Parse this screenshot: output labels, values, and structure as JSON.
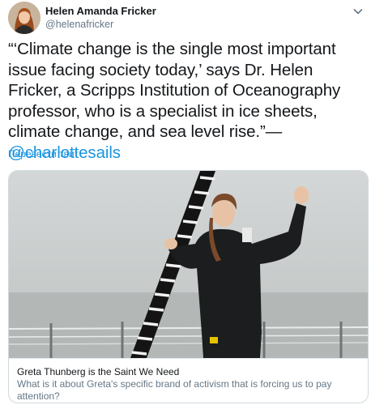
{
  "tweet": {
    "author": {
      "display_name": "Helen Amanda Fricker",
      "handle": "@helenafricker"
    },
    "text": "“‘Climate change is the single most important issue facing society today,’ says Dr. Helen Fricker, a Scripps Institution of Oceanography professor, who is a specialist in ice sheets, climate change, and sea level rise.”—",
    "mention": "@charlottesails",
    "translate_label": "Перевести твит"
  },
  "card": {
    "title": "Greta Thunberg is the Saint We Need",
    "description": "What is it about Greta's specific brand of activism that is forcing us to pay attention?"
  },
  "icons": {
    "caret": "chevron-down-icon"
  },
  "colors": {
    "link": "#1b95e0",
    "text": "#14171a",
    "muted": "#657786",
    "border": "#cfd9de"
  }
}
